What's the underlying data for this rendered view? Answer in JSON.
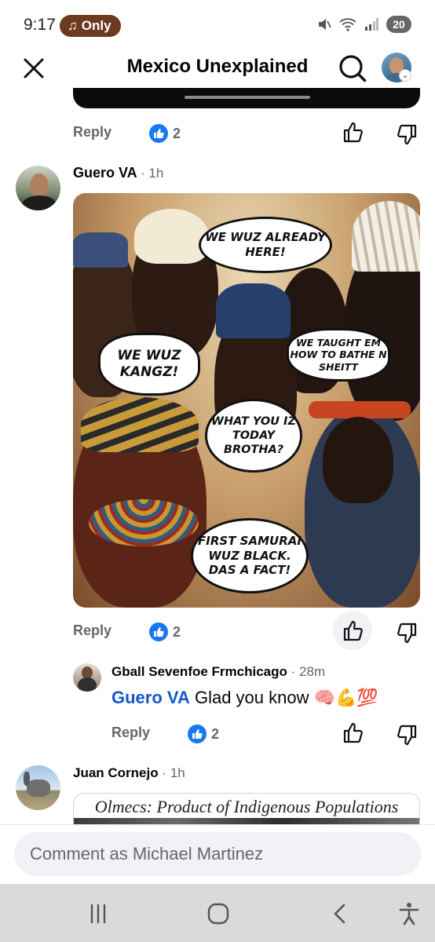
{
  "status_bar": {
    "time": "9:17",
    "pill_label": "Only",
    "battery": "20"
  },
  "app_bar": {
    "title": "Mexico Unexplained"
  },
  "prev_comment_actions": {
    "reply_label": "Reply",
    "reaction_count": "2"
  },
  "comment_guero": {
    "author": "Guero VA",
    "time": "1h",
    "reply_label": "Reply",
    "reaction_count": "2",
    "meme_bubbles": [
      "WE WUZ ALREADY HERE!",
      "WE WUZ KANGZ!",
      "WE TAUGHT EM HOW TO BATHE N SHEITT",
      "WHAT YOU IZ TODAY BROTHA?",
      "FIRST SAMURAI WUZ BLACK. DAS A FACT!"
    ]
  },
  "reply_gball": {
    "author": "Gball Sevenfoe Frmchicago",
    "time": "28m",
    "mention": "Guero VA",
    "text": "Glad you know",
    "emoji": "🧠💪💯",
    "reply_label": "Reply",
    "reaction_count": "2"
  },
  "comment_juan": {
    "author": "Juan Cornejo",
    "time": "1h",
    "preview_title": "Olmecs: Product of Indigenous Populations"
  },
  "composer": {
    "placeholder": "Comment as Michael Martinez"
  },
  "colors": {
    "accent": "#1877f2",
    "mention": "#1458c7",
    "muted": "#65676b",
    "pill": "#6b3a1f"
  },
  "icons": [
    "close-icon",
    "search-icon",
    "like-icon",
    "dislike-icon",
    "recents-icon",
    "home-icon",
    "back-icon",
    "accessibility-icon"
  ]
}
